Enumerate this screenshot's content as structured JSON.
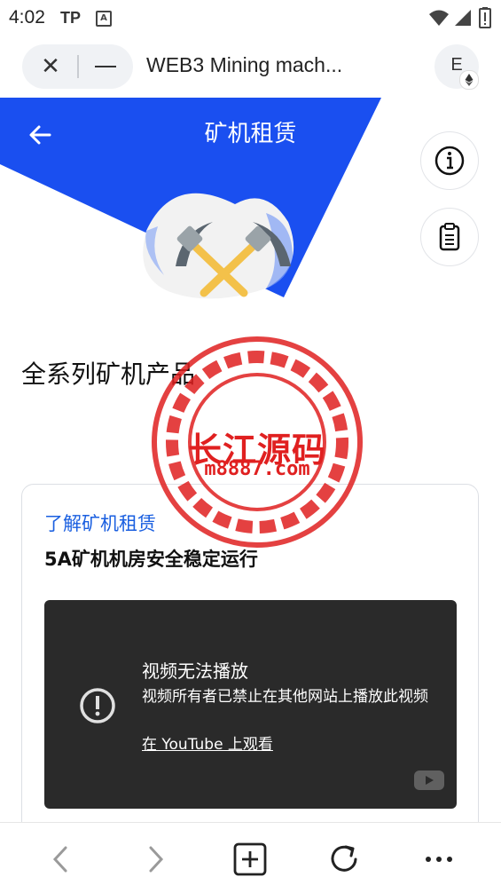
{
  "status_bar": {
    "time": "4:02",
    "carrier_badge": "TP",
    "a_badge": "A",
    "icons": [
      "wifi-icon",
      "signal-icon",
      "battery-icon"
    ]
  },
  "browser": {
    "page_title": "WEB3 Mining mach...",
    "account_letter": "E"
  },
  "header": {
    "title": "矿机租赁",
    "accent_color": "#1a4ff0"
  },
  "section": {
    "heading": "全系列矿机产品"
  },
  "card": {
    "link_text": "了解矿机租赁",
    "subtitle": "5A矿机机房安全稳定运行",
    "video": {
      "title": "视频无法播放",
      "message": "视频所有者已禁止在其他网站上播放此视频",
      "link": "在 YouTube 上观看"
    }
  },
  "watermark": {
    "name": "长江源码",
    "url": "m8887.com"
  },
  "bottom_nav": [
    "back-icon",
    "forward-icon",
    "new-tab-icon",
    "reload-icon",
    "more-icon"
  ]
}
